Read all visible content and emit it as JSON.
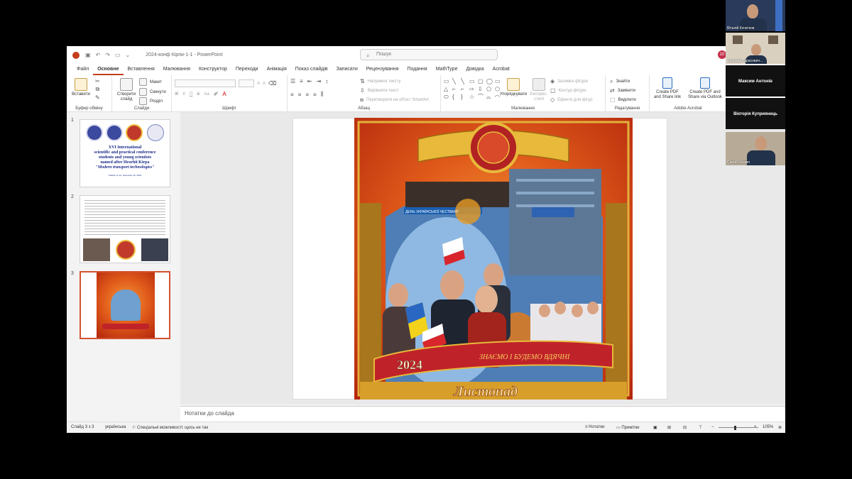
{
  "titlebar": {
    "doc_title": "2024-конф Кірпи-1-1 - PowerPoint",
    "search_placeholder": "Пошук",
    "notification_count": "10"
  },
  "tabs": [
    "Файл",
    "Основне",
    "Вставлення",
    "Малювання",
    "Конструктор",
    "Переходи",
    "Анімація",
    "Показ слайдів",
    "Записати",
    "Рецензування",
    "Подання",
    "MathType",
    "Довідка",
    "Acrobat"
  ],
  "active_tab": "Основне",
  "ribbon": {
    "clipboard": {
      "paste": "Вставити",
      "label": "Буфер обміну"
    },
    "slides": {
      "new_slide_line1": "Створити",
      "new_slide_line2": "слайд",
      "layout": "Макет",
      "reset": "Скинути",
      "section": "Розділ",
      "label": "Слайди"
    },
    "font": {
      "size_up": "A",
      "size_down": "A",
      "bold": "Ж",
      "italic": "К",
      "underline": "П",
      "strike": "S",
      "case": "Аа",
      "label": "Шрифт"
    },
    "paragraph": {
      "text_direction": "Напрямок тексту",
      "align_text": "Вирівняти текст",
      "smartart": "Перетворити на об'єкт SmartArt",
      "label": "Абзац"
    },
    "drawing": {
      "arrange": "Упорядкувати",
      "quick_styles_line1": "Експрес-",
      "quick_styles_line2": "стилі",
      "shape_fill": "Заливка фігури",
      "shape_outline": "Контур фігури",
      "shape_effects": "Ефекти для фігур",
      "label": "Малювання"
    },
    "editing": {
      "find": "Знайти",
      "replace": "Замінити",
      "select": "Виділити",
      "label": "Редагування"
    },
    "acrobat": {
      "create_share_line1": "Create PDF",
      "create_share_line2": "and Share link",
      "create_outlook_line1": "Create PDF and",
      "create_outlook_line2": "Share via Outlook",
      "label": "Adobe Acrobat"
    }
  },
  "thumbnails": [
    {
      "number": "1",
      "title_lines": [
        "XVI International",
        "scientific and practical conference",
        "students and young scientists",
        "named after Heorhii Kirpa",
        "\"Modern transport technologies\""
      ],
      "subtitle": "Kharkiv, 8–13, November 10, 2024"
    },
    {
      "number": "2"
    },
    {
      "number": "3"
    }
  ],
  "slide": {
    "poster_year": "2024",
    "poster_ribbon_text": "ЗНАЄМО І БУДЕМО ВДЯЧНІ",
    "poster_month": "Листопад",
    "poster_banner": "ДЕНЬ УКРАЇНСЬКОЇ ЧЕСТВАНТ"
  },
  "notes_placeholder": "Нотатки до слайда",
  "status": {
    "slide_counter": "Слайд 3 з 3",
    "language": "українська",
    "accessibility": "Спеціальні можливості: щось не так",
    "notes": "Нотатки",
    "comments": "Примітки",
    "zoom": "105%"
  },
  "participants": [
    {
      "name": "Віталій Кочетков"
    },
    {
      "name": "Ярослав Тарасович..."
    },
    {
      "name": "Максим Антонів"
    },
    {
      "name": "Вікторія Куприянець"
    },
    {
      "name": "Сергій Штамп"
    }
  ],
  "colors": {
    "accent": "#c43e1c",
    "selected_thumb_border": "#d35230",
    "badge": "#c4314b"
  }
}
